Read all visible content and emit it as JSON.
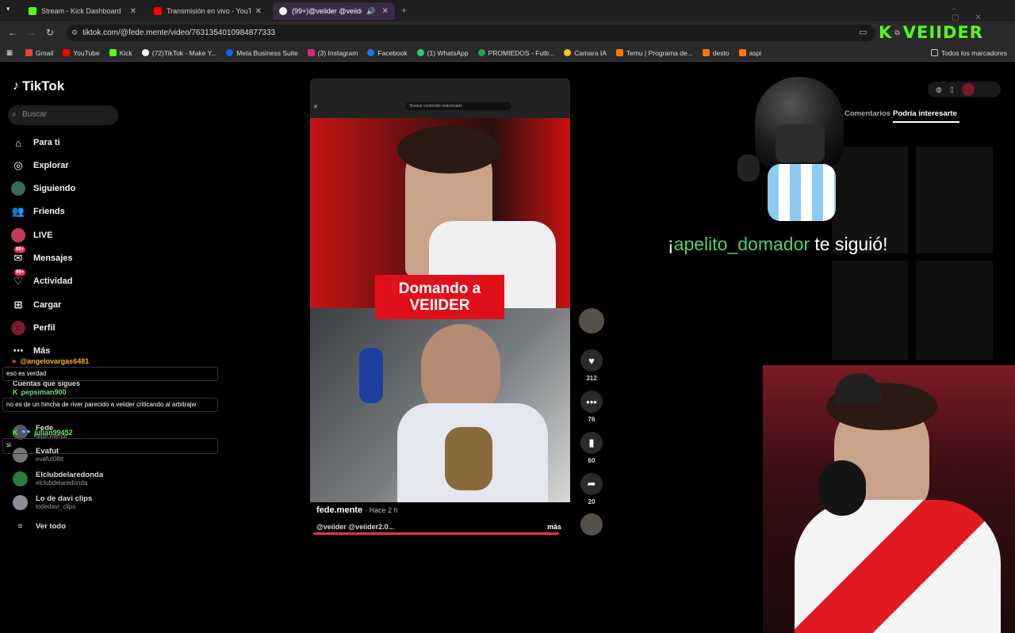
{
  "browser": {
    "tabs": [
      {
        "title": "Stream - Kick Dashboard",
        "color": "#53fc18"
      },
      {
        "title": "Transmisión en vivo - YouTube",
        "color": "#ff0000"
      },
      {
        "title": "(99+)@veiider @veiider2.0",
        "color": "#ffffff"
      }
    ],
    "url": "tiktok.com/@fede.mente/video/7631354010984877333",
    "bookmarks": [
      "Gmail",
      "YouTube",
      "Kick",
      "(72)TikTok - Make Y...",
      "Meta Business Suite",
      "(3) Instagram",
      "Facebook",
      "(1) WhatsApp",
      "PROMIEDOS - Futb...",
      "Camara IA",
      "Temu | Programa de...",
      "desto",
      "aspi"
    ],
    "bookmarks_right": "Todos los marcadores"
  },
  "tiktok": {
    "logo": "TikTok",
    "search_placeholder": "Buscar",
    "nav": [
      {
        "label": "Para ti",
        "icon": "home-icon"
      },
      {
        "label": "Explorar",
        "icon": "compass-icon"
      },
      {
        "label": "Siguiendo",
        "icon": "following-icon"
      },
      {
        "label": "Friends",
        "icon": "friends-icon"
      },
      {
        "label": "LIVE",
        "icon": "live-icon"
      },
      {
        "label": "Mensajes",
        "icon": "messages-icon",
        "badge": "99+"
      },
      {
        "label": "Actividad",
        "icon": "activity-icon",
        "badge": "99+"
      },
      {
        "label": "Cargar",
        "icon": "upload-icon"
      },
      {
        "label": "Perfil",
        "icon": "profile-icon"
      },
      {
        "label": "Más",
        "icon": "more-icon"
      }
    ],
    "following_header": "Cuentas que sigues",
    "accounts": [
      {
        "name": "Fede",
        "handle": "fede.mente"
      },
      {
        "name": "Evafut",
        "handle": "evafut08tt"
      },
      {
        "name": "Elclubdelaredonda",
        "handle": "elclubdelaredonda"
      },
      {
        "name": "Lo de davi clips",
        "handle": "lodedavi_clips"
      }
    ],
    "see_all": "Ver todo",
    "video": {
      "caption_line1": "Domando a",
      "caption_line2": "VEIIDER",
      "author": "fede.mente",
      "time": "· Hace 2 h",
      "description": "@veiider @veiider2.0...",
      "more": "más",
      "likes": "312",
      "comments": "76",
      "saves": "60",
      "shares": "20",
      "inner_search": "Buscar contenido relacionado"
    },
    "right_tabs": {
      "comments": "Comentarios",
      "recommended": "Podría interesarte"
    }
  },
  "chat": [
    {
      "user": "@angelovargas6481",
      "msg": "eso es verdad"
    },
    {
      "user": "pepsiman900",
      "msg": "no es de un hincha de river parecido a veiider criticando al arbitrajw"
    },
    {
      "user": "julian99452",
      "msg": "si"
    }
  ],
  "overlay": {
    "kick_brand": "VEIIDER",
    "follow_prefix": "¡",
    "follow_user": "apelito_domador",
    "follow_suffix": " te siguió!"
  }
}
